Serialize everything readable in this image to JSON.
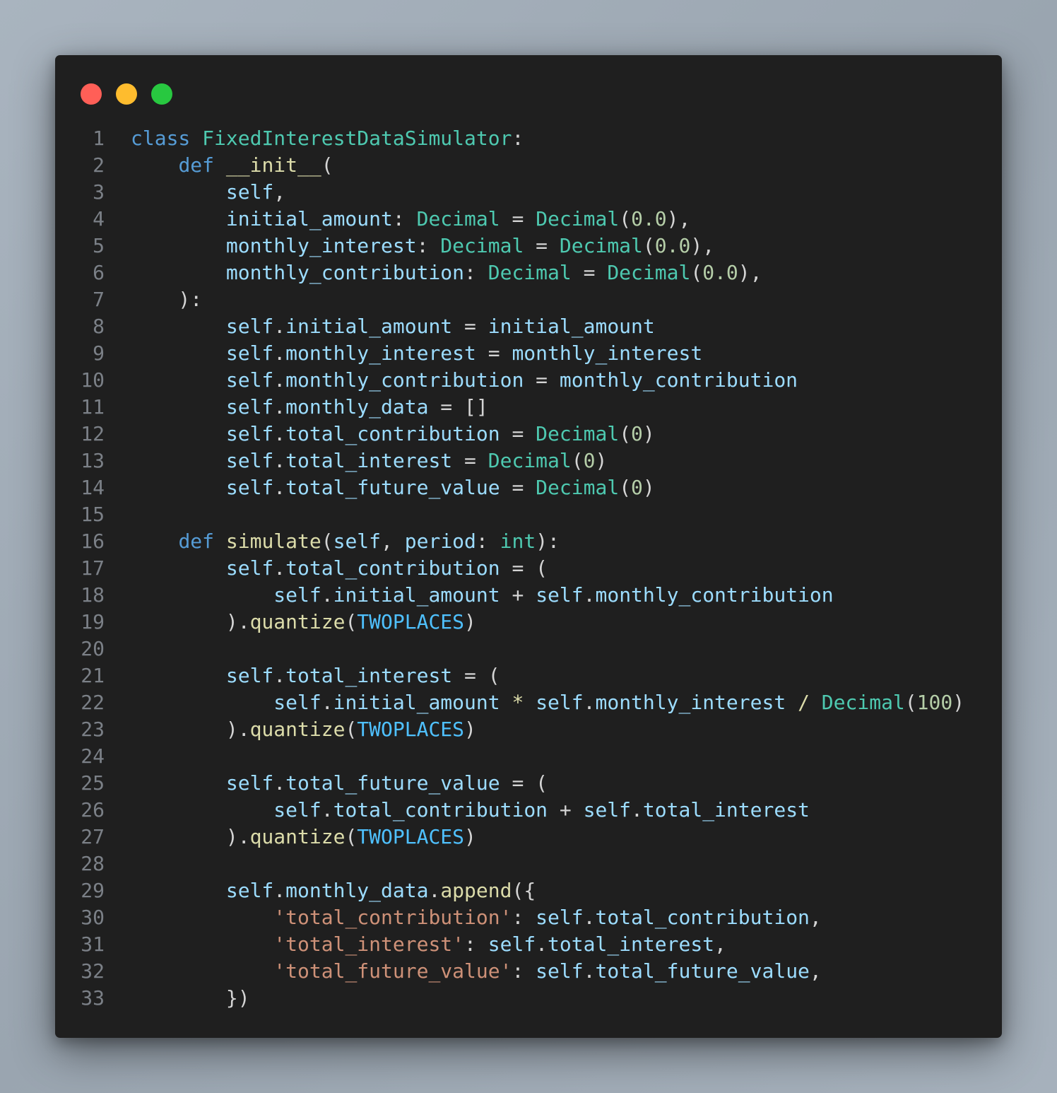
{
  "window": {
    "controls": [
      {
        "name": "close",
        "color": "#ff5f57"
      },
      {
        "name": "minimize",
        "color": "#febc2e"
      },
      {
        "name": "maximize",
        "color": "#28c840"
      }
    ]
  },
  "code": {
    "language": "python",
    "lines": [
      [
        [
          "kw",
          "class"
        ],
        [
          "op",
          " "
        ],
        [
          "cls",
          "FixedInterestDataSimulator"
        ],
        [
          "op",
          ":"
        ]
      ],
      [
        [
          "op",
          "    "
        ],
        [
          "kw",
          "def"
        ],
        [
          "op",
          " "
        ],
        [
          "fn",
          "__init__"
        ],
        [
          "op",
          "("
        ]
      ],
      [
        [
          "op",
          "        "
        ],
        [
          "var",
          "self"
        ],
        [
          "op",
          ","
        ]
      ],
      [
        [
          "op",
          "        "
        ],
        [
          "var",
          "initial_amount"
        ],
        [
          "op",
          ": "
        ],
        [
          "cls",
          "Decimal"
        ],
        [
          "op",
          " = "
        ],
        [
          "cls",
          "Decimal"
        ],
        [
          "op",
          "("
        ],
        [
          "num",
          "0.0"
        ],
        [
          "op",
          "),"
        ]
      ],
      [
        [
          "op",
          "        "
        ],
        [
          "var",
          "monthly_interest"
        ],
        [
          "op",
          ": "
        ],
        [
          "cls",
          "Decimal"
        ],
        [
          "op",
          " = "
        ],
        [
          "cls",
          "Decimal"
        ],
        [
          "op",
          "("
        ],
        [
          "num",
          "0.0"
        ],
        [
          "op",
          "),"
        ]
      ],
      [
        [
          "op",
          "        "
        ],
        [
          "var",
          "monthly_contribution"
        ],
        [
          "op",
          ": "
        ],
        [
          "cls",
          "Decimal"
        ],
        [
          "op",
          " = "
        ],
        [
          "cls",
          "Decimal"
        ],
        [
          "op",
          "("
        ],
        [
          "num",
          "0.0"
        ],
        [
          "op",
          "),"
        ]
      ],
      [
        [
          "op",
          "    ):"
        ]
      ],
      [
        [
          "op",
          "        "
        ],
        [
          "var",
          "self"
        ],
        [
          "op",
          "."
        ],
        [
          "var",
          "initial_amount"
        ],
        [
          "op",
          " = "
        ],
        [
          "var",
          "initial_amount"
        ]
      ],
      [
        [
          "op",
          "        "
        ],
        [
          "var",
          "self"
        ],
        [
          "op",
          "."
        ],
        [
          "var",
          "monthly_interest"
        ],
        [
          "op",
          " = "
        ],
        [
          "var",
          "monthly_interest"
        ]
      ],
      [
        [
          "op",
          "        "
        ],
        [
          "var",
          "self"
        ],
        [
          "op",
          "."
        ],
        [
          "var",
          "monthly_contribution"
        ],
        [
          "op",
          " = "
        ],
        [
          "var",
          "monthly_contribution"
        ]
      ],
      [
        [
          "op",
          "        "
        ],
        [
          "var",
          "self"
        ],
        [
          "op",
          "."
        ],
        [
          "var",
          "monthly_data"
        ],
        [
          "op",
          " = []"
        ]
      ],
      [
        [
          "op",
          "        "
        ],
        [
          "var",
          "self"
        ],
        [
          "op",
          "."
        ],
        [
          "var",
          "total_contribution"
        ],
        [
          "op",
          " = "
        ],
        [
          "cls",
          "Decimal"
        ],
        [
          "op",
          "("
        ],
        [
          "num",
          "0"
        ],
        [
          "op",
          ")"
        ]
      ],
      [
        [
          "op",
          "        "
        ],
        [
          "var",
          "self"
        ],
        [
          "op",
          "."
        ],
        [
          "var",
          "total_interest"
        ],
        [
          "op",
          " = "
        ],
        [
          "cls",
          "Decimal"
        ],
        [
          "op",
          "("
        ],
        [
          "num",
          "0"
        ],
        [
          "op",
          ")"
        ]
      ],
      [
        [
          "op",
          "        "
        ],
        [
          "var",
          "self"
        ],
        [
          "op",
          "."
        ],
        [
          "var",
          "total_future_value"
        ],
        [
          "op",
          " = "
        ],
        [
          "cls",
          "Decimal"
        ],
        [
          "op",
          "("
        ],
        [
          "num",
          "0"
        ],
        [
          "op",
          ")"
        ]
      ],
      [],
      [
        [
          "op",
          "    "
        ],
        [
          "kw",
          "def"
        ],
        [
          "op",
          " "
        ],
        [
          "fn",
          "simulate"
        ],
        [
          "op",
          "("
        ],
        [
          "var",
          "self"
        ],
        [
          "op",
          ", "
        ],
        [
          "var",
          "period"
        ],
        [
          "op",
          ": "
        ],
        [
          "cls",
          "int"
        ],
        [
          "op",
          "):"
        ]
      ],
      [
        [
          "op",
          "        "
        ],
        [
          "var",
          "self"
        ],
        [
          "op",
          "."
        ],
        [
          "var",
          "total_contribution"
        ],
        [
          "op",
          " = ("
        ]
      ],
      [
        [
          "op",
          "            "
        ],
        [
          "var",
          "self"
        ],
        [
          "op",
          "."
        ],
        [
          "var",
          "initial_amount"
        ],
        [
          "op",
          " + "
        ],
        [
          "var",
          "self"
        ],
        [
          "op",
          "."
        ],
        [
          "var",
          "monthly_contribution"
        ]
      ],
      [
        [
          "op",
          "        )."
        ],
        [
          "fn",
          "quantize"
        ],
        [
          "op",
          "("
        ],
        [
          "const",
          "TWOPLACES"
        ],
        [
          "op",
          ")"
        ]
      ],
      [],
      [
        [
          "op",
          "        "
        ],
        [
          "var",
          "self"
        ],
        [
          "op",
          "."
        ],
        [
          "var",
          "total_interest"
        ],
        [
          "op",
          " = ("
        ]
      ],
      [
        [
          "op",
          "            "
        ],
        [
          "var",
          "self"
        ],
        [
          "op",
          "."
        ],
        [
          "var",
          "initial_amount"
        ],
        [
          "op",
          " "
        ],
        [
          "fn",
          "*"
        ],
        [
          "op",
          " "
        ],
        [
          "var",
          "self"
        ],
        [
          "op",
          "."
        ],
        [
          "var",
          "monthly_interest"
        ],
        [
          "op",
          " "
        ],
        [
          "fn",
          "/"
        ],
        [
          "op",
          " "
        ],
        [
          "cls",
          "Decimal"
        ],
        [
          "op",
          "("
        ],
        [
          "num",
          "100"
        ],
        [
          "op",
          ")"
        ]
      ],
      [
        [
          "op",
          "        )."
        ],
        [
          "fn",
          "quantize"
        ],
        [
          "op",
          "("
        ],
        [
          "const",
          "TWOPLACES"
        ],
        [
          "op",
          ")"
        ]
      ],
      [],
      [
        [
          "op",
          "        "
        ],
        [
          "var",
          "self"
        ],
        [
          "op",
          "."
        ],
        [
          "var",
          "total_future_value"
        ],
        [
          "op",
          " = ("
        ]
      ],
      [
        [
          "op",
          "            "
        ],
        [
          "var",
          "self"
        ],
        [
          "op",
          "."
        ],
        [
          "var",
          "total_contribution"
        ],
        [
          "op",
          " + "
        ],
        [
          "var",
          "self"
        ],
        [
          "op",
          "."
        ],
        [
          "var",
          "total_interest"
        ]
      ],
      [
        [
          "op",
          "        )."
        ],
        [
          "fn",
          "quantize"
        ],
        [
          "op",
          "("
        ],
        [
          "const",
          "TWOPLACES"
        ],
        [
          "op",
          ")"
        ]
      ],
      [],
      [
        [
          "op",
          "        "
        ],
        [
          "var",
          "self"
        ],
        [
          "op",
          "."
        ],
        [
          "var",
          "monthly_data"
        ],
        [
          "op",
          "."
        ],
        [
          "fn",
          "append"
        ],
        [
          "op",
          "({"
        ]
      ],
      [
        [
          "op",
          "            "
        ],
        [
          "str",
          "'total_contribution'"
        ],
        [
          "op",
          ": "
        ],
        [
          "var",
          "self"
        ],
        [
          "op",
          "."
        ],
        [
          "var",
          "total_contribution"
        ],
        [
          "op",
          ","
        ]
      ],
      [
        [
          "op",
          "            "
        ],
        [
          "str",
          "'total_interest'"
        ],
        [
          "op",
          ": "
        ],
        [
          "var",
          "self"
        ],
        [
          "op",
          "."
        ],
        [
          "var",
          "total_interest"
        ],
        [
          "op",
          ","
        ]
      ],
      [
        [
          "op",
          "            "
        ],
        [
          "str",
          "'total_future_value'"
        ],
        [
          "op",
          ": "
        ],
        [
          "var",
          "self"
        ],
        [
          "op",
          "."
        ],
        [
          "var",
          "total_future_value"
        ],
        [
          "op",
          ","
        ]
      ],
      [
        [
          "op",
          "        })"
        ]
      ]
    ]
  }
}
